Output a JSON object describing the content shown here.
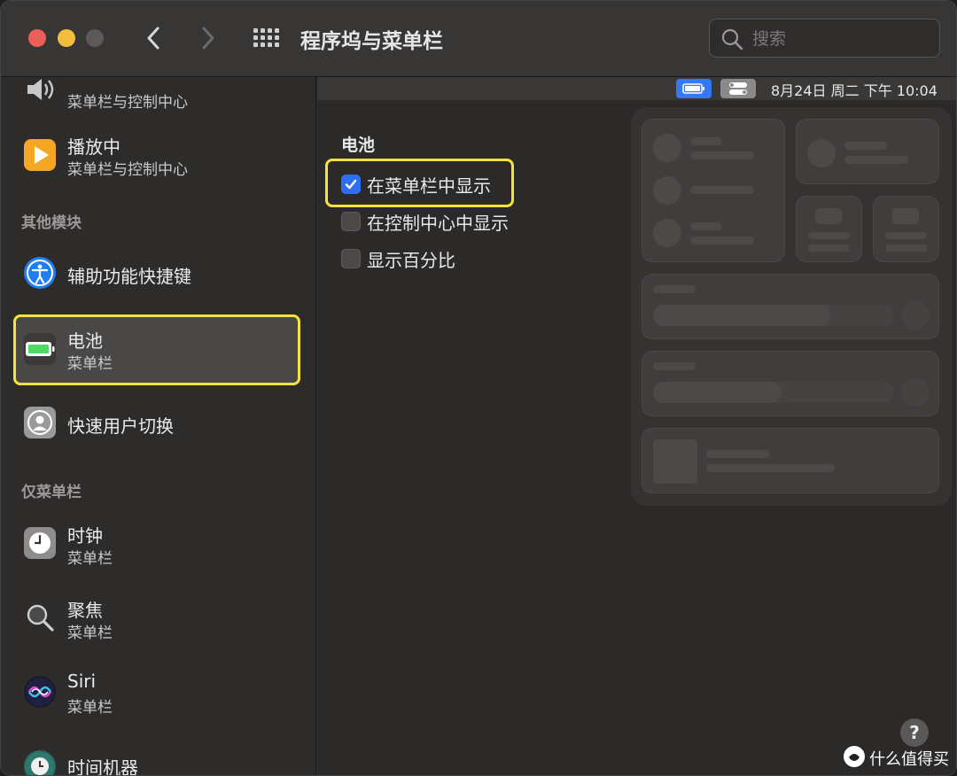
{
  "window": {
    "title": "程序坞与菜单栏",
    "search_placeholder": "搜索"
  },
  "sidebar": {
    "items_top": [
      {
        "label": "",
        "sub": "菜单栏与控制中心",
        "icon": "speaker-icon"
      },
      {
        "label": "播放中",
        "sub": "菜单栏与控制中心",
        "icon": "now-playing-icon"
      }
    ],
    "section_other": "其他模块",
    "items_other": [
      {
        "label": "辅助功能快捷键",
        "icon": "accessibility-icon"
      },
      {
        "label": "电池",
        "sub": "菜单栏",
        "icon": "battery-icon",
        "selected": true
      },
      {
        "label": "快速用户切换",
        "icon": "user-switch-icon"
      }
    ],
    "section_menubar_only": "仅菜单栏",
    "items_menubar": [
      {
        "label": "时钟",
        "sub": "菜单栏",
        "icon": "clock-icon"
      },
      {
        "label": "聚焦",
        "sub": "菜单栏",
        "icon": "spotlight-icon"
      },
      {
        "label": "Siri",
        "sub": "菜单栏",
        "icon": "siri-icon"
      },
      {
        "label": "时间机器",
        "icon": "time-machine-icon"
      }
    ]
  },
  "menubar_preview": {
    "datetime": "8月24日 周二 下午 10:04"
  },
  "battery_section": {
    "title": "电池",
    "options": [
      {
        "label": "在菜单栏中显示",
        "checked": true
      },
      {
        "label": "在控制中心中显示",
        "checked": false
      },
      {
        "label": "显示百分比",
        "checked": false
      }
    ]
  },
  "help_label": "?",
  "watermark": "什么值得买",
  "colors": {
    "accent": "#2f6ef0",
    "highlight": "#f6e23e",
    "battery_green": "#4cd964"
  }
}
